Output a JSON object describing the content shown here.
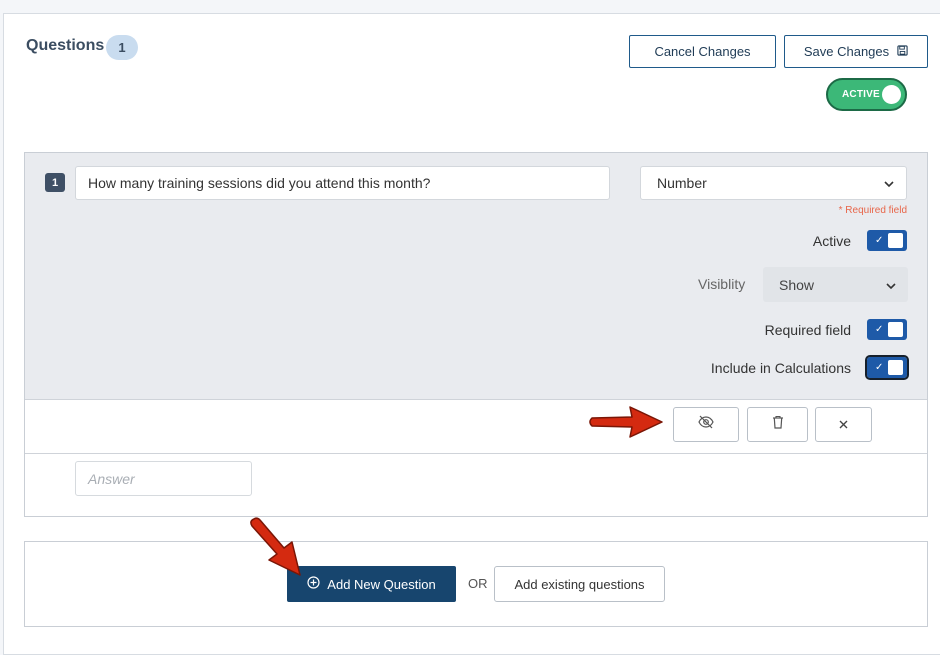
{
  "header": {
    "title": "Questions",
    "count": "1",
    "cancel_label": "Cancel Changes",
    "save_label": "Save Changes",
    "status_toggle_label": "ACTIVE"
  },
  "question": {
    "number": "1",
    "text": "How many training sessions did you attend this month?",
    "type": "Number",
    "required_note": "* Required field",
    "active_label": "Active",
    "active_checked": true,
    "visibility_label": "Visiblity",
    "visibility_value": "Show",
    "required_label": "Required field",
    "required_checked": true,
    "calculations_label": "Include in Calculations",
    "calculations_checked": true,
    "answer_placeholder": "Answer"
  },
  "actions": {
    "hide_icon": "eye-slash-icon",
    "delete_icon": "trash-icon",
    "close_icon": "close-icon"
  },
  "footer": {
    "add_new_label": "Add New Question",
    "or_text": "OR",
    "add_existing_label": "Add existing questions"
  },
  "colors": {
    "primary": "#17456e",
    "active_green": "#3cb878",
    "toggle_blue": "#1e5aa8",
    "required_note": "#e8664a",
    "annotation_arrow": "#d42a10"
  }
}
